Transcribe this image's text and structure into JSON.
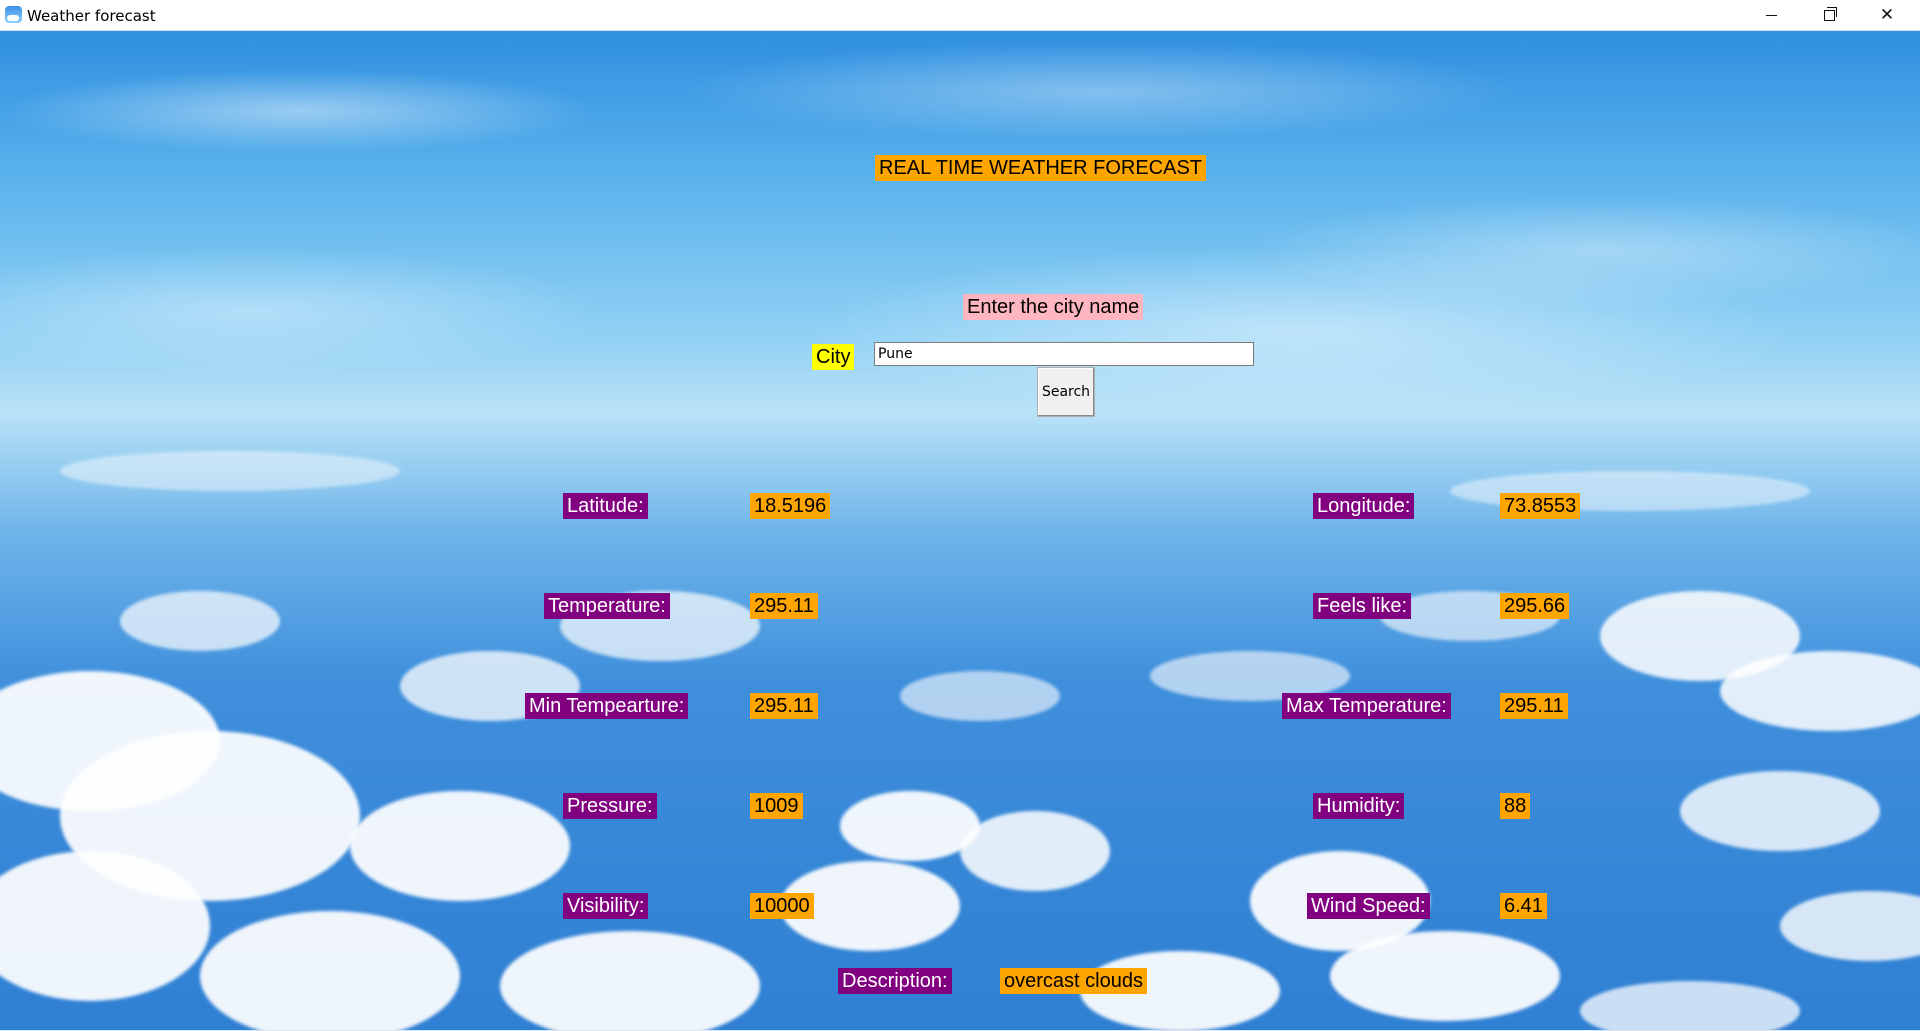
{
  "window": {
    "title": "Weather forecast",
    "controls": {
      "minimize": "minimize",
      "maximize": "restore",
      "close": "close"
    }
  },
  "header": {
    "title": "REAL TIME WEATHER FORECAST",
    "prompt": "Enter the city name"
  },
  "search": {
    "city_label": "City",
    "city_value": "Pune",
    "button_label": "Search"
  },
  "results": {
    "latitude": {
      "label": "Latitude:",
      "value": "18.5196"
    },
    "longitude": {
      "label": "Longitude:",
      "value": "73.8553"
    },
    "temperature": {
      "label": "Temperature:",
      "value": "295.11"
    },
    "feels_like": {
      "label": "Feels like:",
      "value": "295.66"
    },
    "min_temperature": {
      "label": "Min Tempearture:",
      "value": "295.11"
    },
    "max_temperature": {
      "label": "Max Temperature:",
      "value": "295.11"
    },
    "pressure": {
      "label": "Pressure:",
      "value": "1009"
    },
    "humidity": {
      "label": "Humidity:",
      "value": "88"
    },
    "visibility": {
      "label": "Visibility:",
      "value": "10000"
    },
    "wind_speed": {
      "label": "Wind Speed:",
      "value": "6.41"
    },
    "description": {
      "label": "Description:",
      "value": "overcast clouds"
    }
  },
  "colors": {
    "title_bg": "#ffa500",
    "prompt_bg": "#ffb6c1",
    "city_label_bg": "#ffff00",
    "field_label_bg": "#800080",
    "value_bg": "#ffa500",
    "sky": "#3f8fdc"
  }
}
